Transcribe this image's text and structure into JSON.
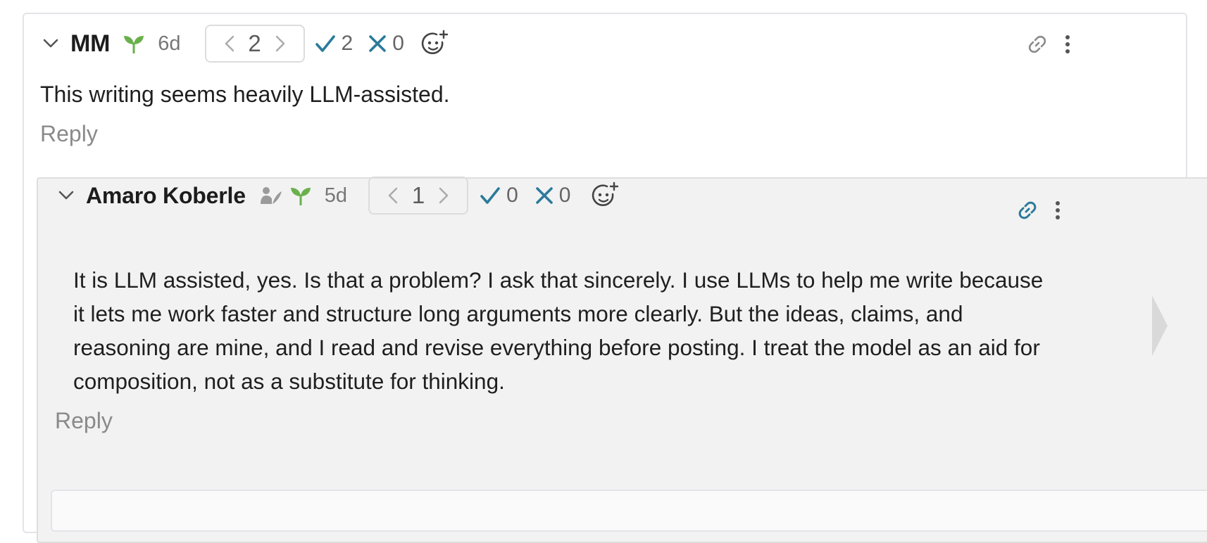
{
  "comment": {
    "author": "MM",
    "age": "6d",
    "karma": "2",
    "agree_count": "2",
    "disagree_count": "0",
    "body": "This writing seems heavily LLM-assisted.",
    "reply_label": "Reply"
  },
  "reply_comment": {
    "author": "Amaro Koberle",
    "age": "5d",
    "karma": "1",
    "agree_count": "0",
    "disagree_count": "0",
    "body": "It is LLM assisted, yes. Is that a problem? I ask that sincerely. I use LLMs to help me write because it lets me work faster and structure long arguments more clearly. But the ideas, claims, and reasoning are mine, and I read and revise everything before posting. I treat the model as an aid for composition, not as a substitute for thinking.",
    "reply_label": "Reply"
  },
  "icons": {
    "collapse": "chevron-down-icon",
    "new_user": "sprout-icon",
    "author_badge": "author-quill-icon",
    "karma_down": "chevron-left-icon",
    "karma_up": "chevron-right-icon",
    "agree": "check-icon",
    "disagree": "x-icon",
    "add_reaction": "add-emoji-icon",
    "permalink": "link-icon",
    "menu": "kebab-menu-icon"
  },
  "colors": {
    "agree": "#2b7a9b",
    "disagree": "#2b7a9b",
    "sprout": "#6ab04c",
    "link_active": "#2b7a9b",
    "link_inactive": "#8a8a8a",
    "nested_bg": "#f2f2f2"
  }
}
